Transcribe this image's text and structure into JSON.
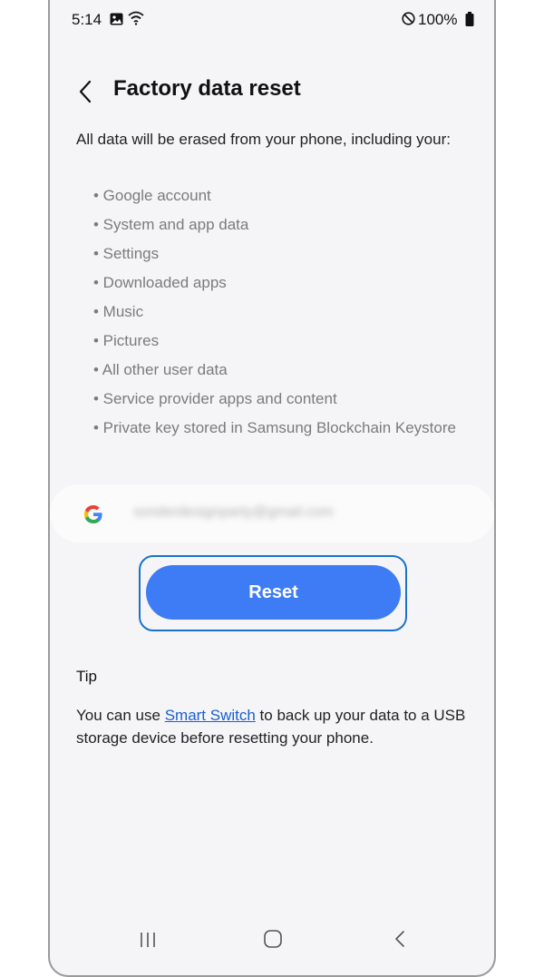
{
  "status_bar": {
    "time": "5:14",
    "battery": "100%"
  },
  "header": {
    "title": "Factory data reset"
  },
  "intro_text": "All data will be erased from your phone, including your:",
  "erase_items": [
    "• Google account",
    "• System and app data",
    "• Settings",
    "• Downloaded apps",
    "• Music",
    "• Pictures",
    "• All other user data",
    "• Service provider apps and content",
    "• Private key stored in Samsung Blockchain Keystore"
  ],
  "account": {
    "email": "sonderdesignparty@gmail.com",
    "icon": "google-icon"
  },
  "reset_button": {
    "label": "Reset"
  },
  "tip": {
    "heading": "Tip",
    "prefix": "You can use ",
    "link": "Smart Switch",
    "suffix": " to back up your data to a USB storage device before resetting your phone."
  },
  "colors": {
    "accent": "#3e7cf6",
    "focus_ring": "#1a73c9",
    "link": "#1a5fd0",
    "background": "#f5f5f7"
  },
  "icons": [
    "gallery-icon",
    "wifi-icon",
    "do-not-disturb-icon",
    "battery-icon",
    "back-arrow-icon",
    "google-icon",
    "recents-icon",
    "home-icon",
    "nav-back-icon"
  ]
}
